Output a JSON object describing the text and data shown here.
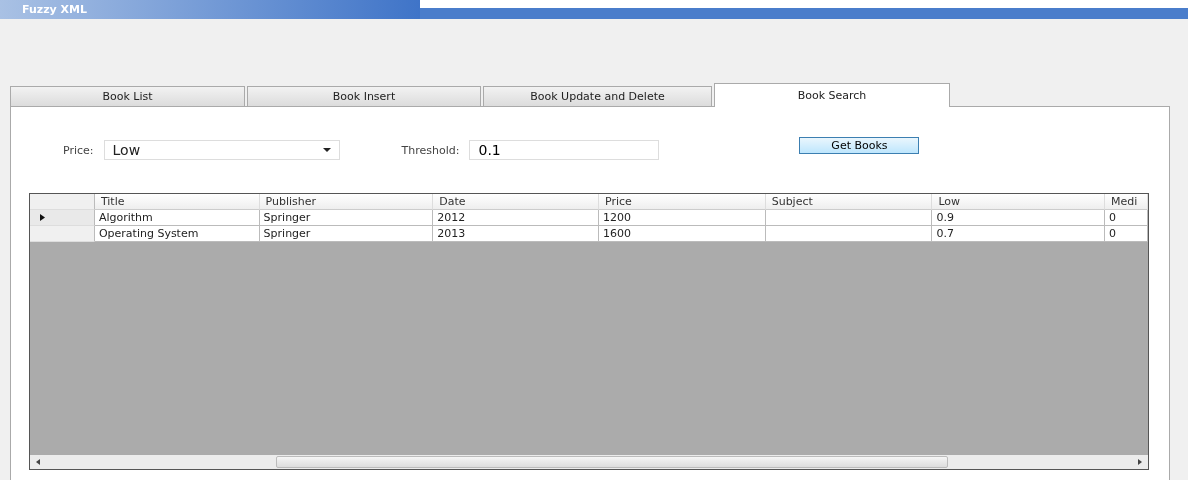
{
  "window": {
    "title": "Fuzzy XML"
  },
  "tabs": [
    {
      "label": "Book List",
      "selected": false
    },
    {
      "label": "Book Insert",
      "selected": false
    },
    {
      "label": "Book Update and Delete",
      "selected": false
    },
    {
      "label": "Book Search",
      "selected": true
    }
  ],
  "price": {
    "label": "Price:",
    "value": "Low"
  },
  "threshold": {
    "label": "Threshold:",
    "value": "0.1"
  },
  "get_books_button": "Get Books",
  "table": {
    "columns": [
      "Title",
      "Publisher",
      "Date",
      "Price",
      "Subject",
      "Low",
      "Medi"
    ],
    "rows": [
      {
        "current": true,
        "cells": [
          "Algorithm",
          "Springer",
          "2012",
          "1200",
          "",
          "0.9",
          "0"
        ]
      },
      {
        "current": false,
        "cells": [
          "Operating System",
          "Springer",
          "2013",
          "1600",
          "",
          "0.7",
          "0"
        ]
      }
    ]
  }
}
